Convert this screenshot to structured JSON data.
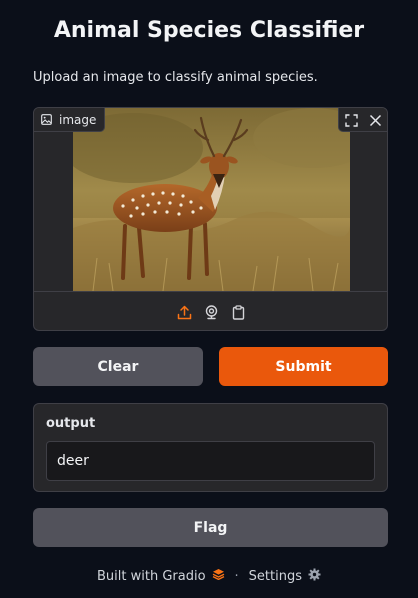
{
  "app": {
    "title": "Animal Species Classifier",
    "description": "Upload an image to classify animal species."
  },
  "image_input": {
    "label": "image",
    "icons": {
      "label": "image-icon",
      "fullscreen": "fullscreen-icon",
      "clear": "close-icon",
      "upload": "upload-icon",
      "webcam": "webcam-icon",
      "clipboard": "clipboard-icon"
    },
    "image_subject": "spotted deer (chital) standing in dry grass"
  },
  "buttons": {
    "clear": "Clear",
    "submit": "Submit",
    "flag": "Flag"
  },
  "output": {
    "label": "output",
    "value": "deer"
  },
  "footer": {
    "built_with": "Built with Gradio",
    "separator": "·",
    "settings": "Settings"
  },
  "colors": {
    "background": "#0b0f19",
    "panel": "#27272a",
    "border": "#3f3f46",
    "secondary_button": "#52525b",
    "primary_button": "#ea580c",
    "accent_icon": "#f97316"
  }
}
